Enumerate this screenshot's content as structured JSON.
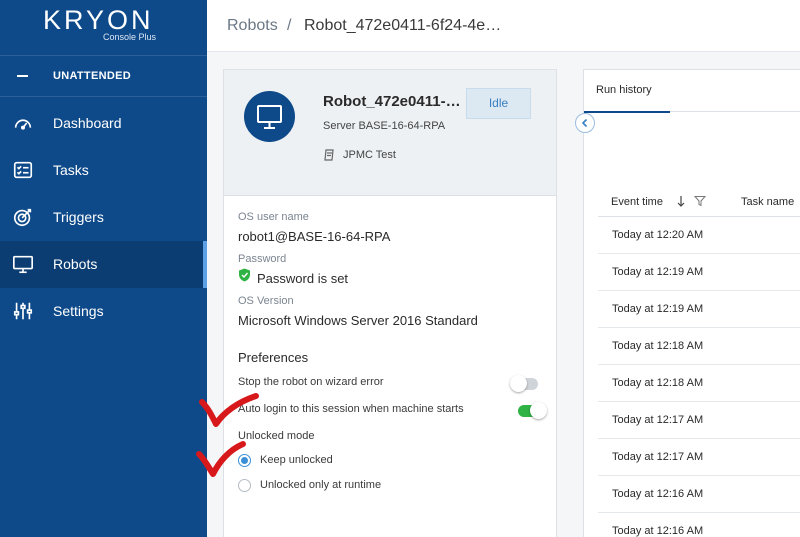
{
  "brand": {
    "name": "KRYON",
    "subtitle": "Console Plus"
  },
  "sidebar": {
    "section_label": "UNATTENDED",
    "items": [
      {
        "label": "Dashboard",
        "icon": "gauge-icon"
      },
      {
        "label": "Tasks",
        "icon": "checklist-icon"
      },
      {
        "label": "Triggers",
        "icon": "target-icon"
      },
      {
        "label": "Robots",
        "icon": "monitor-icon"
      },
      {
        "label": "Settings",
        "icon": "sliders-icon"
      }
    ],
    "active_item": "Robots"
  },
  "breadcrumb": {
    "root": "Robots",
    "separator": "/",
    "current": "Robot_472e0411-6f24-4e…"
  },
  "robot": {
    "name": "Robot_472e0411-…",
    "status": "Idle",
    "server": "Server BASE-16-64-RPA",
    "group": "JPMC Test"
  },
  "details": {
    "os_user_label": "OS user name",
    "os_user_value": "robot1@BASE-16-64-RPA",
    "password_label": "Password",
    "password_value": "Password is set",
    "os_version_label": "OS Version",
    "os_version_value": "Microsoft Windows Server 2016 Standard"
  },
  "preferences": {
    "title": "Preferences",
    "stop_on_error_label": "Stop the robot on wizard error",
    "stop_on_error": false,
    "auto_login_label": "Auto login to this session when machine starts",
    "auto_login": true,
    "unlocked_mode_label": "Unlocked mode",
    "unlocked_options": [
      "Keep unlocked",
      "Unlocked only at runtime"
    ],
    "unlocked_selected": "Keep unlocked"
  },
  "run_history": {
    "tab_label": "Run history",
    "columns": [
      "Event time",
      "Task name"
    ],
    "rows": [
      "Today at 12:20 AM",
      "Today at 12:19 AM",
      "Today at 12:19 AM",
      "Today at 12:18 AM",
      "Today at 12:18 AM",
      "Today at 12:17 AM",
      "Today at 12:17 AM",
      "Today at 12:16 AM",
      "Today at 12:16 AM"
    ]
  },
  "colors": {
    "sidebar": "#0e4a8a",
    "sidebar_active": "#0b3c72",
    "accent": "#3a8fd6",
    "toggle_on": "#2fb344",
    "annotation_check": "#d7191c"
  }
}
